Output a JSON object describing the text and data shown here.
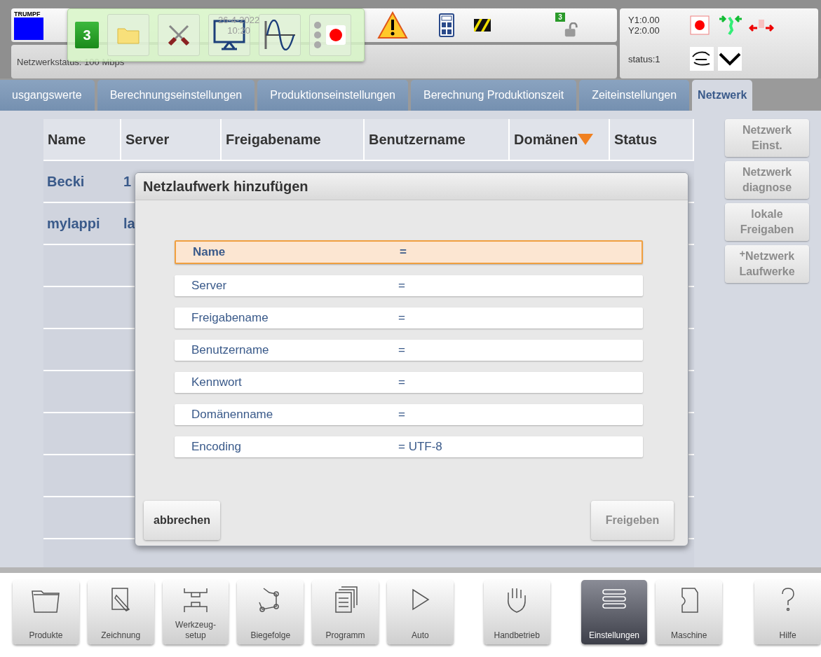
{
  "header": {
    "logo": "TRUMPF",
    "date": "26-4-2022",
    "time": "10:20",
    "network_status": "Netzwerkstatus: 100 Mbps",
    "lock_badge": "3",
    "y1": "Y1:0.00",
    "y2": "Y2:0.00",
    "status": "status:1"
  },
  "overlay_toolbar": {
    "badge": "3"
  },
  "tabs": [
    {
      "label": "usgangswerte",
      "selected": false
    },
    {
      "label": "Berechnungseinstellungen",
      "selected": false
    },
    {
      "label": "Produktionseinstellungen",
      "selected": false
    },
    {
      "label": "Berechnung Produktionszeit",
      "selected": false
    },
    {
      "label": "Zeiteinstellungen",
      "selected": false
    },
    {
      "label": "Netzwerk",
      "selected": true
    }
  ],
  "table": {
    "columns": [
      {
        "label": "Name",
        "sorted": false
      },
      {
        "label": "Server",
        "sorted": false
      },
      {
        "label": "Freigabename",
        "sorted": false
      },
      {
        "label": "Benutzername",
        "sorted": false
      },
      {
        "label": "Domänen",
        "sorted": true
      },
      {
        "label": "Status",
        "sorted": false
      }
    ],
    "rows": [
      [
        "Becki",
        "1"
      ],
      [
        "mylappi",
        "la"
      ]
    ]
  },
  "side_buttons": [
    {
      "label": "Netzwerk Einst.",
      "disabled": true,
      "plus": false
    },
    {
      "label": "Netzwerk diagnose",
      "disabled": true,
      "plus": false
    },
    {
      "label": "lokale Freigaben",
      "disabled": true,
      "plus": false
    },
    {
      "label": "Netzwerk Laufwerke",
      "disabled": true,
      "plus": "+"
    }
  ],
  "dialog": {
    "title": "Netzlaufwerk hinzufügen",
    "fields": [
      {
        "label": "Name",
        "value": "=",
        "selected": true
      },
      {
        "label": "Server",
        "value": "=",
        "selected": false
      },
      {
        "label": "Freigabename",
        "value": "=",
        "selected": false
      },
      {
        "label": "Benutzername",
        "value": "=",
        "selected": false
      },
      {
        "label": "Kennwort",
        "value": "=",
        "selected": false
      },
      {
        "label": "Domänenname",
        "value": "=",
        "selected": false
      },
      {
        "label": "Encoding",
        "value": "=  UTF-8",
        "selected": false
      }
    ],
    "buttons": [
      {
        "label": "abbrechen",
        "disabled": false
      },
      {
        "label": "Freigeben",
        "disabled": true
      }
    ]
  },
  "bottom_nav": [
    {
      "label": "Produkte",
      "selected": false
    },
    {
      "label": "Zeichnung",
      "selected": false
    },
    {
      "label": "Werkzeug-\nsetup",
      "selected": false
    },
    {
      "label": "Biegefolge",
      "selected": false
    },
    {
      "label": "Programm",
      "selected": false
    },
    {
      "label": "Auto",
      "selected": false
    },
    {
      "label": "Handbetrieb",
      "selected": false
    },
    {
      "label": "Einstellungen",
      "selected": true
    },
    {
      "label": "Maschine",
      "selected": false
    },
    {
      "label": "Hilfe",
      "selected": false
    }
  ]
}
